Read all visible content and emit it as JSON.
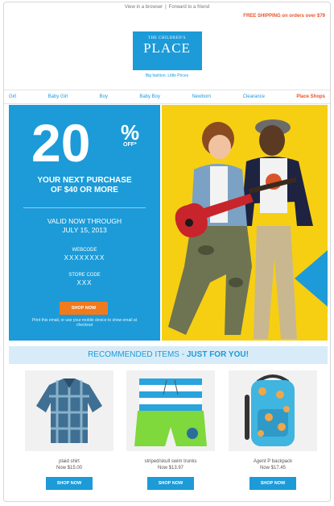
{
  "topbar": {
    "view_browser": "View in a browser",
    "forward": "Forward to a friend",
    "promo": "FREE SHIPPING on orders over $79"
  },
  "logo": {
    "line1": "THE CHILDREN'S",
    "line2": "PLACE",
    "tagline": "Big fashion. Little Prices"
  },
  "nav": {
    "items": [
      "Girl",
      "Baby Girl",
      "Boy",
      "Baby Boy",
      "Newborn",
      "Clearance"
    ],
    "hot": "Place Shops"
  },
  "offer": {
    "percent": "20",
    "percent_symbol": "%",
    "off_label": "OFF*",
    "purchase_line1": "YOUR NEXT PURCHASE",
    "purchase_line2": "OF $40 OR MORE",
    "valid_line1": "VALID NOW THROUGH",
    "valid_line2": "JULY 15, 2013",
    "webcode_label": "WEBCODE",
    "webcode_value": "XXXXXXXX",
    "storecode_label": "STORE CODE",
    "storecode_value": "XXX",
    "button": "SHOP NOW",
    "fine_print": "Print this email, or use your mobile device to show email at checkout"
  },
  "recommended": {
    "label": "RECOMMENDED ITEMS - ",
    "emphasis": "JUST FOR YOU!"
  },
  "products": [
    {
      "name": "plaid shirt",
      "price": "Now $15.00",
      "button": "SHOP NOW"
    },
    {
      "name": "striped/skull swim trunks",
      "price": "Now $13.97",
      "button": "SHOP NOW"
    },
    {
      "name": "Agent P backpack",
      "price": "Now $17.45",
      "button": "SHOP NOW"
    }
  ],
  "colors": {
    "brand_blue": "#1c9bd8",
    "accent_orange": "#f07a1e",
    "hero_yellow": "#f6cf13"
  }
}
